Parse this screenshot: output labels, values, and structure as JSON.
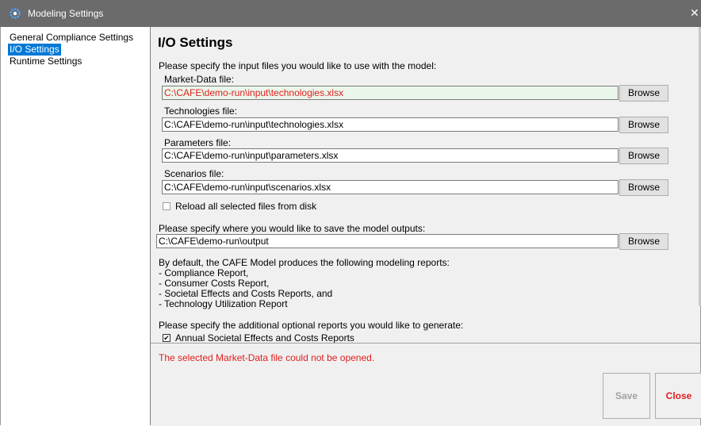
{
  "window": {
    "title": "Modeling Settings",
    "close_glyph": "✕"
  },
  "nav": {
    "items": [
      {
        "label": "General Compliance Settings"
      },
      {
        "label": "I/O Settings"
      },
      {
        "label": "Runtime Settings"
      }
    ],
    "selected": "I/O Settings"
  },
  "io": {
    "heading": "I/O Settings",
    "input_prompt": "Please specify the input files you would like to use with the model:",
    "market_label": "Market-Data file:",
    "market_value": "C:\\CAFE\\demo-run\\input\\technologies.xlsx",
    "tech_label": "Technologies file:",
    "tech_value": "C:\\CAFE\\demo-run\\input\\technologies.xlsx",
    "params_label": "Parameters file:",
    "params_value": "C:\\CAFE\\demo-run\\input\\parameters.xlsx",
    "scen_label": "Scenarios file:",
    "scen_value": "C:\\CAFE\\demo-run\\input\\scenarios.xlsx",
    "browse_label": "Browse",
    "reload_label": "Reload all selected files from disk",
    "reload_checked": false,
    "output_prompt": "Please specify where you would like to save the model outputs:",
    "output_value": "C:\\CAFE\\demo-run\\output",
    "reports_intro": "By default, the CAFE Model produces the following modeling reports:",
    "reports": [
      " - Compliance Report,",
      " - Consumer Costs  Report,",
      " - Societal Effects and Costs Reports, and",
      " - Technology Utilization Report"
    ],
    "optional_prompt": "Please specify the additional optional reports you would like to generate:",
    "annual_label": "Annual Societal Effects and Costs Reports",
    "annual_checked": true,
    "check_glyph": "✔"
  },
  "footer": {
    "error": "The selected Market-Data file could not be opened.",
    "save_label": "Save",
    "close_label": "Close"
  },
  "colors": {
    "error": "#e02020",
    "titlebar": "#6b6b6b",
    "selection": "#0078d7"
  }
}
